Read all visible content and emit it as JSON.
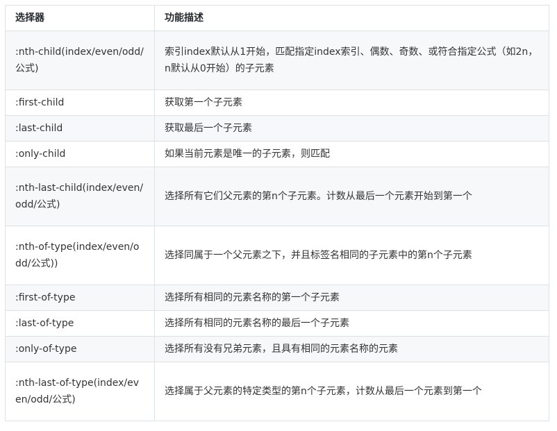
{
  "table": {
    "headers": [
      "选择器",
      "功能描述"
    ],
    "rows": [
      {
        "selector": ":nth-child(index/even/odd/公式)",
        "description": "索引index默认从1开始，匹配指定index索引、偶数、奇数、或符合指定公式（如2n，n默认从0开始）的子元素"
      },
      {
        "selector": ":first-child",
        "description": "获取第一个子元素"
      },
      {
        "selector": ":last-child",
        "description": "获取最后一个子元素"
      },
      {
        "selector": ":only-child",
        "description": "如果当前元素是唯一的子元素，则匹配"
      },
      {
        "selector": ":nth-last-child(index/even/odd/公式)",
        "description": "选择所有它们父元素的第n个子元素。计数从最后一个元素开始到第一个"
      },
      {
        "selector": ":nth-of-type(index/even/odd/公式))",
        "description": "选择同属于一个父元素之下，并且标签名相同的子元素中的第n个子元素"
      },
      {
        "selector": ":first-of-type",
        "description": "选择所有相同的元素名称的第一个子元素"
      },
      {
        "selector": ":last-of-type",
        "description": "选择所有相同的元素名称的最后一个子元素"
      },
      {
        "selector": ":only-of-type",
        "description": "选择所有没有兄弟元素，且具有相同的元素名称的元素"
      },
      {
        "selector": ":nth-last-of-type(index/even/odd/公式)",
        "description": "选择属于父元素的特定类型的第n个子元素，计数从最后一个元素到第一个"
      }
    ]
  }
}
